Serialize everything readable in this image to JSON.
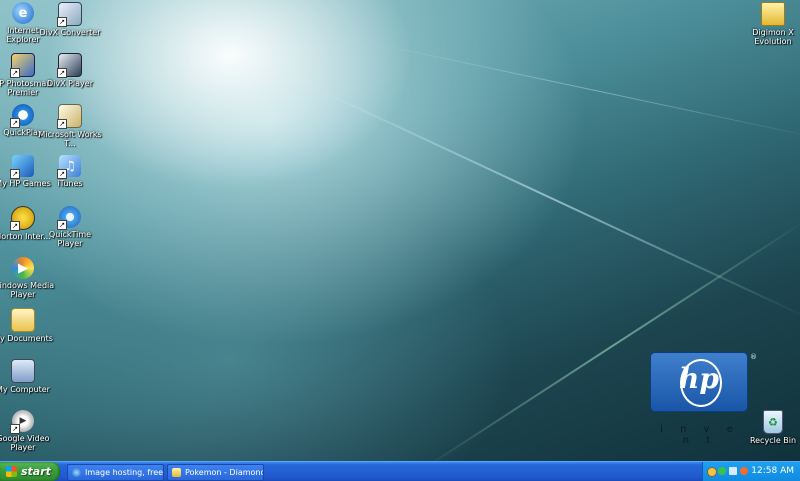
{
  "desktop": {
    "icons": {
      "ie": {
        "label": "Internet Explorer",
        "icon": "internet-explorer-icon"
      },
      "dvx_converter": {
        "label": "DivX Converter",
        "icon": "divx-converter-icon"
      },
      "hp_photosmart": {
        "label": "HP Photosmart Premier",
        "icon": "hp-photosmart-icon"
      },
      "divx_player": {
        "label": "DivX Player",
        "icon": "divx-player-icon"
      },
      "quickplay": {
        "label": "QuickPlay",
        "icon": "quickplay-icon"
      },
      "works": {
        "label": "Microsoft Works T...",
        "icon": "microsoft-works-icon"
      },
      "my_hp_games": {
        "label": "My HP Games",
        "icon": "my-hp-games-icon"
      },
      "itunes": {
        "label": "iTunes",
        "icon": "itunes-icon"
      },
      "norton": {
        "label": "Norton Inter...",
        "icon": "norton-icon"
      },
      "quicktime": {
        "label": "QuickTime Player",
        "icon": "quicktime-icon"
      },
      "wmp": {
        "label": "Windows Media Player",
        "icon": "windows-media-player-icon"
      },
      "my_documents": {
        "label": "My Documents",
        "icon": "my-documents-icon"
      },
      "my_computer": {
        "label": "My Computer",
        "icon": "my-computer-icon"
      },
      "google_video": {
        "label": "Google Video Player",
        "icon": "google-video-player-icon"
      },
      "digimon": {
        "label": "Digimon X Evolution",
        "icon": "folder-icon"
      },
      "recycle_bin": {
        "label": "Recycle Bin",
        "icon": "recycle-bin-icon"
      }
    },
    "wallpaper_logo": {
      "text": "hp",
      "reg": "®",
      "tagline": "i n v e n t",
      "color": "#1a56a8"
    }
  },
  "taskbar": {
    "start_label": "start",
    "tasks": [
      {
        "label": "Image hosting, free p..."
      },
      {
        "label": "Pokemon - Diamond a..."
      }
    ],
    "tray": {
      "clock": "12:58 AM"
    }
  }
}
